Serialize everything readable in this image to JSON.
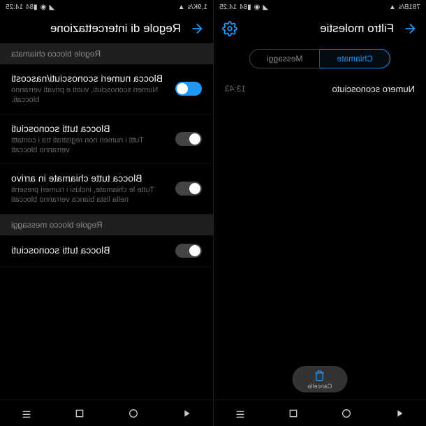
{
  "status": {
    "left_speed_a": "781B/s",
    "left_speed_b": "1,9K/s",
    "time": "14:25",
    "battery": "84"
  },
  "left_phone": {
    "header_title": "Filtro molestie",
    "tabs": {
      "calls": "Chiamate",
      "messages": "Messaggi"
    },
    "entry": {
      "title": "Numero sconosciuto",
      "time": "13:43"
    },
    "delete_label": "Cancella"
  },
  "right_phone": {
    "header_title": "Regole di intercettazione",
    "section_calls": "Regole blocco chiamata",
    "section_messages": "Regole blocco messaggi",
    "settings": {
      "s1": {
        "title": "Blocca numeri sconosciuti/nascosti",
        "desc": "Numeri sconosciuti, vuoti e privati verranno bloccati."
      },
      "s2": {
        "title": "Blocca tutti sconosciuti",
        "desc": "Tutti i numeri non registrati tra i contatti verranno bloccati"
      },
      "s3": {
        "title": "Blocca tutte chiamate in arrivo",
        "desc": "Tutte le chiamate, inclusi i numeri presenti nella lista bianca verranno bloccati"
      },
      "s4": {
        "title": "Blocca tutti sconosciuti"
      }
    }
  }
}
